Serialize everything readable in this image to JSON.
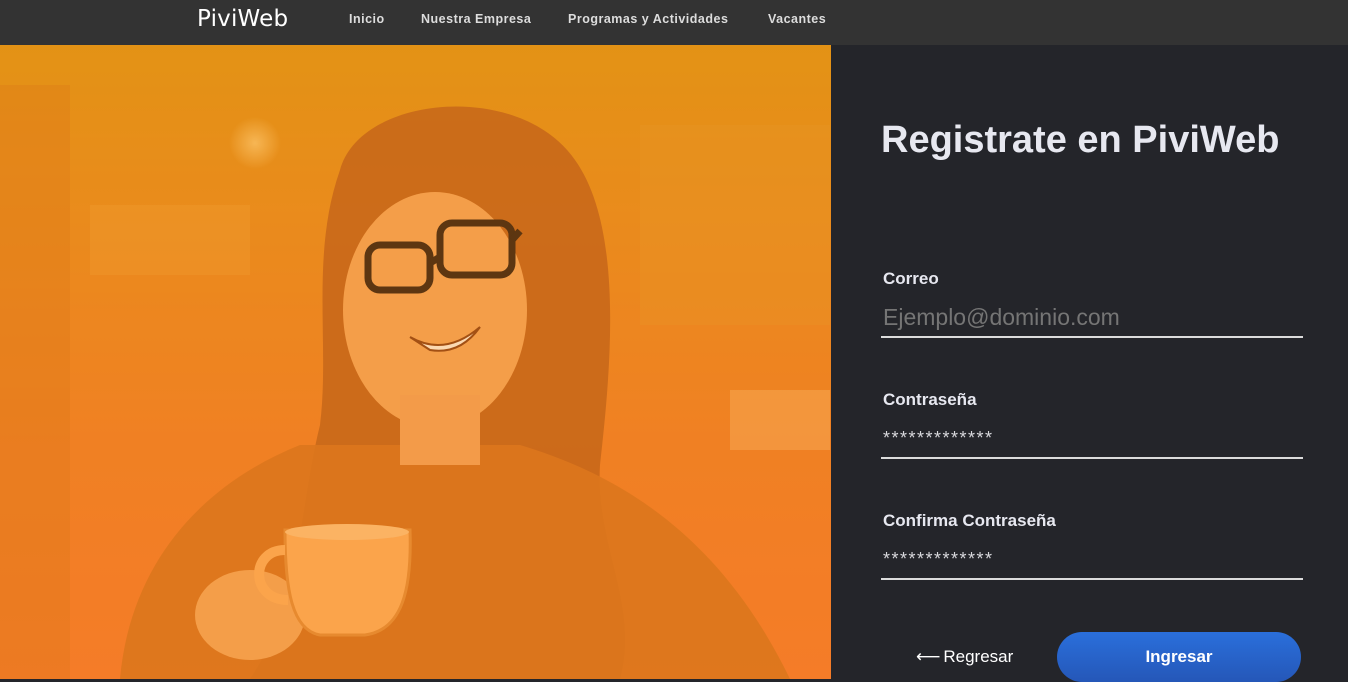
{
  "navbar": {
    "brand": "PiviWeb",
    "links": [
      "Inicio",
      "Nuestra Empresa",
      "Programas y Actividades",
      "Vacantes"
    ]
  },
  "hero": {
    "image": "woman-with-glasses-holding-coffee-cup-photo",
    "overlay_color": "#f08a1e"
  },
  "form": {
    "title": "Registrate en PiviWeb",
    "email_label": "Correo",
    "email_placeholder": "Ejemplo@dominio.com",
    "password_label": "Contraseña",
    "password_value": "*************",
    "confirm_label": "Confirma Contraseña",
    "confirm_value": "*************",
    "back_icon": "arrow-left-icon",
    "back_label": "Regresar",
    "submit_label": "Ingresar"
  },
  "colors": {
    "navbar_bg": "#333333",
    "panel_bg": "#24252a",
    "accent_blue": "#2a63cf",
    "overlay_orange": "#f08a1e"
  }
}
